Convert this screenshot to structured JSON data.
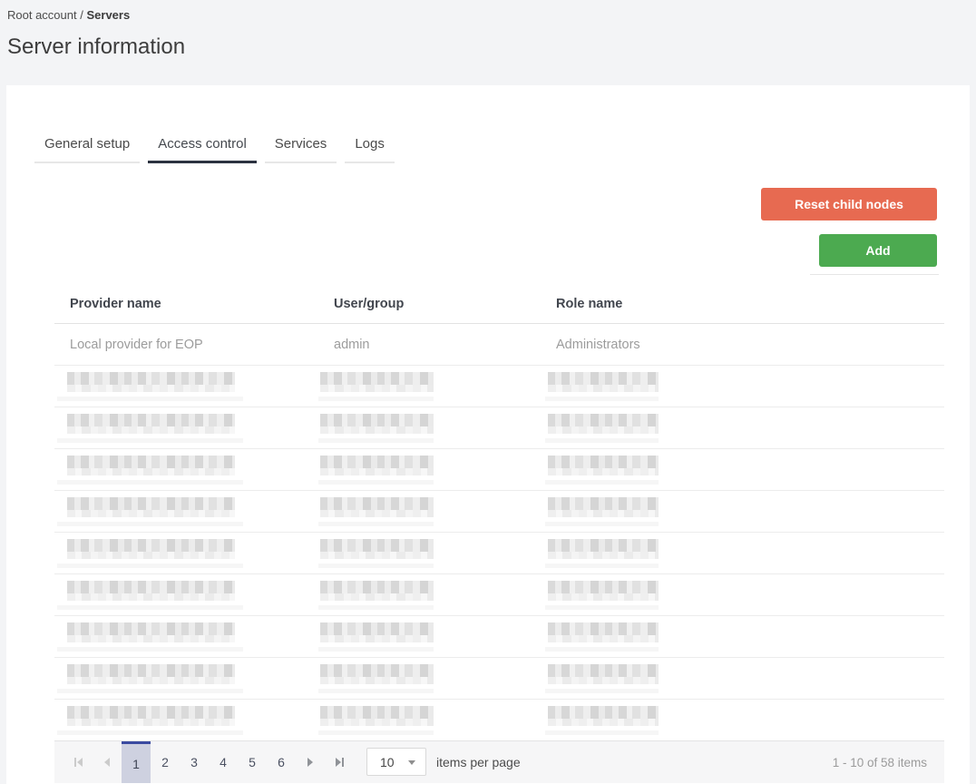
{
  "breadcrumb": {
    "root": "Root account",
    "separator": "/",
    "current": "Servers"
  },
  "page": {
    "title": "Server information"
  },
  "tabs": [
    {
      "id": "general-setup",
      "label": "General setup",
      "active": false
    },
    {
      "id": "access-control",
      "label": "Access control",
      "active": true
    },
    {
      "id": "services",
      "label": "Services",
      "active": false
    },
    {
      "id": "logs",
      "label": "Logs",
      "active": false
    }
  ],
  "toolbar": {
    "reset_button": "Reset child nodes",
    "add_button": "Add"
  },
  "table": {
    "columns": [
      "Provider name",
      "User/group",
      "Role name"
    ],
    "rows": [
      {
        "provider": "Local provider for EOP",
        "user_group": "admin",
        "role": "Administrators",
        "redacted": false
      },
      {
        "redacted": true
      },
      {
        "redacted": true
      },
      {
        "redacted": true
      },
      {
        "redacted": true
      },
      {
        "redacted": true
      },
      {
        "redacted": true
      },
      {
        "redacted": true
      },
      {
        "redacted": true
      },
      {
        "redacted": true
      }
    ]
  },
  "pagination": {
    "pages": [
      "1",
      "2",
      "3",
      "4",
      "5",
      "6"
    ],
    "current_page": "1",
    "page_size": "10",
    "items_per_page_label": "items per page",
    "range_label": "1 - 10 of 58 items"
  },
  "colors": {
    "page_bg": "#f3f4f6",
    "reset_button_bg": "#e76a51",
    "add_button_bg": "#4caa50",
    "tab_active_underline": "#2c3240",
    "active_page_bg": "#ced1e0",
    "active_page_border": "#3b4ba1"
  }
}
